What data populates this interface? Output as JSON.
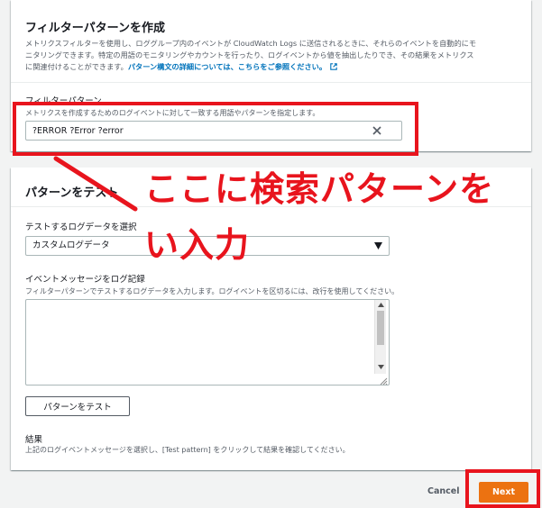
{
  "filter_panel": {
    "title": "フィルターパターンを作成",
    "description_line1": "メトリクスフィルターを使用し、ロググループ内のイベントが CloudWatch Logs に送信されるときに、それらのイベントを自動的にモ",
    "description_line2": "ニタリングできます。特定の用語のモニタリングやカウントを行ったり、ログイベントから値を抽出したりでき、その結果をメトリクス",
    "description_line3": "に関連付けることができます。",
    "syntax_link": "パターン構文の詳細については、こちらをご参照ください。",
    "filter_pattern_label": "フィルターパターン",
    "filter_pattern_hint": "メトリクスを作成するためのログイベントに対して一致する用語やパターンを指定します。",
    "filter_pattern_value": "?ERROR ?Error ?error"
  },
  "test_panel": {
    "title": "パターンをテスト",
    "log_data_label": "テストするログデータを選択",
    "log_data_selected": "カスタムログデータ",
    "event_message_label": "イベントメッセージをログ記録",
    "event_message_hint": "フィルターパターンでテストするログデータを入力します。ログイベントを区切るには、改行を使用してください。",
    "event_message_value": "",
    "test_button_label": "パターンをテスト",
    "results_label": "結果",
    "results_hint": "上記のログイベントメッセージを選択し、[Test pattern] をクリックして結果を確認してください。"
  },
  "footer": {
    "cancel_label": "Cancel",
    "next_label": "Next"
  },
  "annotation": {
    "line1": "ここに検索パターンを",
    "line2": "い入力",
    "color": "#e8141d"
  },
  "colors": {
    "accent": "#ec7211",
    "link": "#0073bb",
    "annotation": "#e8141d"
  },
  "icons": {
    "clear": "close-icon",
    "dropdown": "caret-down-icon",
    "external_link": "external-link-icon"
  }
}
